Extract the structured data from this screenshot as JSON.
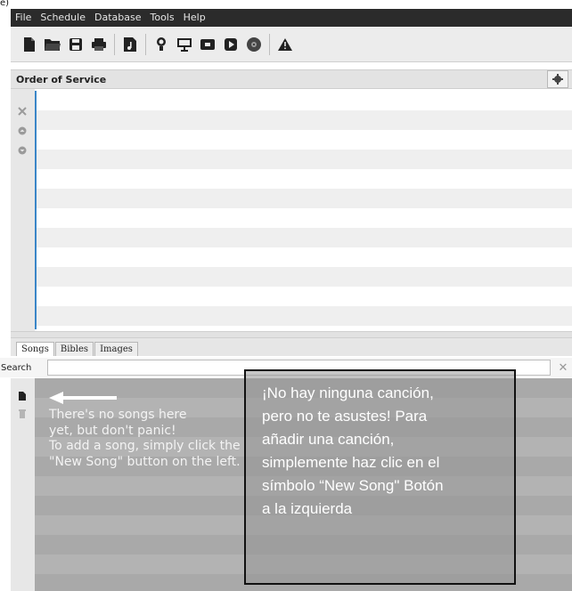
{
  "corner_label": "e)",
  "menu": [
    "File",
    "Schedule",
    "Database",
    "Tools",
    "Help"
  ],
  "toolbar": {
    "icons": [
      "new-file-icon",
      "open-folder-icon",
      "save-icon",
      "print-icon",
      "music-icon",
      "bulb-icon",
      "presentation-icon",
      "video-icon",
      "play-icon",
      "disc-icon",
      "warning-icon"
    ]
  },
  "order_panel": {
    "title": "Order of Service"
  },
  "tabs": [
    "Songs",
    "Bibles",
    "Images"
  ],
  "search": {
    "label": "Search",
    "value": ""
  },
  "songs": {
    "empty_lines": [
      "There's no songs here",
      "yet, but don't panic!",
      "To add a song, simply click the",
      "\"New Song\" button on the left."
    ]
  },
  "overlay": {
    "lines": [
      "¡No hay ninguna canción,",
      "pero no te asustes!  Para",
      "añadir una canción,",
      "simplemente haz clic en el",
      "símbolo “New Song\" Botón",
      "a la izquierda"
    ]
  },
  "colors": {
    "menubar": "#2b2b2b",
    "accent": "#3a86c8",
    "songs_bg": "#a9a9a9"
  }
}
